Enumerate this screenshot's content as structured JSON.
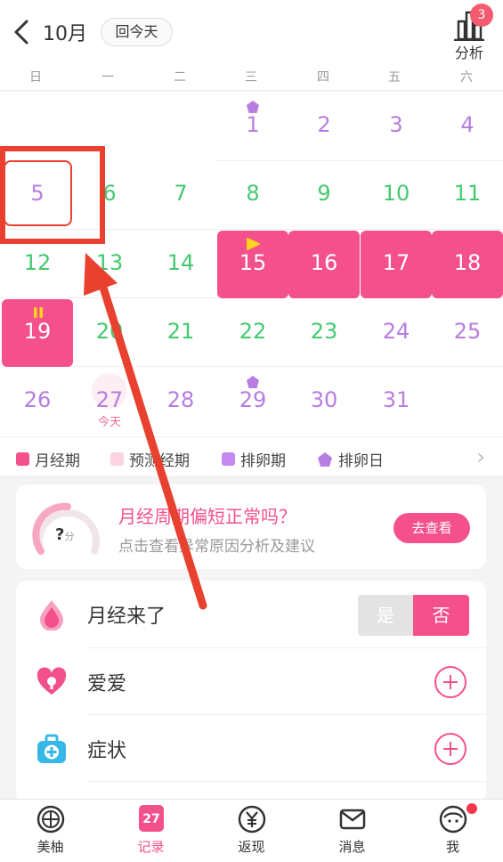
{
  "header": {
    "month": "10月",
    "today_button": "回今天",
    "analysis_label": "分析",
    "badge": "3"
  },
  "weekdays": [
    "日",
    "一",
    "二",
    "三",
    "四",
    "五",
    "六"
  ],
  "calendar": {
    "days": [
      {
        "day": "1",
        "col": 3,
        "row": 0,
        "type": "purple",
        "marker": "ovulation-day"
      },
      {
        "day": "2",
        "col": 4,
        "row": 0,
        "type": "purple"
      },
      {
        "day": "3",
        "col": 5,
        "row": 0,
        "type": "purple"
      },
      {
        "day": "4",
        "col": 6,
        "row": 0,
        "type": "purple"
      },
      {
        "day": "5",
        "col": 0,
        "row": 1,
        "type": "purple"
      },
      {
        "day": "6",
        "col": 1,
        "row": 1,
        "type": "green"
      },
      {
        "day": "7",
        "col": 2,
        "row": 1,
        "type": "green"
      },
      {
        "day": "8",
        "col": 3,
        "row": 1,
        "type": "green"
      },
      {
        "day": "9",
        "col": 4,
        "row": 1,
        "type": "green"
      },
      {
        "day": "10",
        "col": 5,
        "row": 1,
        "type": "green"
      },
      {
        "day": "11",
        "col": 6,
        "row": 1,
        "type": "green"
      },
      {
        "day": "12",
        "col": 0,
        "row": 2,
        "type": "green"
      },
      {
        "day": "13",
        "col": 1,
        "row": 2,
        "type": "green"
      },
      {
        "day": "14",
        "col": 2,
        "row": 2,
        "type": "green"
      },
      {
        "day": "15",
        "col": 3,
        "row": 2,
        "type": "period",
        "marker": "start"
      },
      {
        "day": "16",
        "col": 4,
        "row": 2,
        "type": "period"
      },
      {
        "day": "17",
        "col": 5,
        "row": 2,
        "type": "period"
      },
      {
        "day": "18",
        "col": 6,
        "row": 2,
        "type": "period"
      },
      {
        "day": "19",
        "col": 0,
        "row": 3,
        "type": "period",
        "marker": "end"
      },
      {
        "day": "20",
        "col": 1,
        "row": 3,
        "type": "green"
      },
      {
        "day": "21",
        "col": 2,
        "row": 3,
        "type": "green"
      },
      {
        "day": "22",
        "col": 3,
        "row": 3,
        "type": "green"
      },
      {
        "day": "23",
        "col": 4,
        "row": 3,
        "type": "green"
      },
      {
        "day": "24",
        "col": 5,
        "row": 3,
        "type": "purple"
      },
      {
        "day": "25",
        "col": 6,
        "row": 3,
        "type": "purple"
      },
      {
        "day": "26",
        "col": 0,
        "row": 4,
        "type": "purple"
      },
      {
        "day": "27",
        "col": 1,
        "row": 4,
        "type": "purple",
        "marker": "today",
        "sub": "今天"
      },
      {
        "day": "28",
        "col": 2,
        "row": 4,
        "type": "purple"
      },
      {
        "day": "29",
        "col": 3,
        "row": 4,
        "type": "purple",
        "marker": "ovulation-day"
      },
      {
        "day": "30",
        "col": 4,
        "row": 4,
        "type": "purple"
      },
      {
        "day": "31",
        "col": 5,
        "row": 4,
        "type": "purple"
      }
    ]
  },
  "legend": {
    "items": [
      {
        "label": "月经期",
        "color": "#f4508b"
      },
      {
        "label": "预测经期",
        "color": "#fbd3e1"
      },
      {
        "label": "排卵期",
        "color": "#c48af0"
      },
      {
        "label": "排卵日",
        "color": "#b77de0"
      }
    ]
  },
  "cycle_card": {
    "score": "?",
    "score_unit": "分",
    "title": "月经周期偏短正常吗？",
    "subtitle": "点击查看异常原因分析及建议",
    "button": "去查看"
  },
  "records": {
    "period": {
      "label": "月经来了",
      "yes": "是",
      "no": "否",
      "selected": "否"
    },
    "love": {
      "label": "爱爱"
    },
    "symptom": {
      "label": "症状"
    }
  },
  "tabs": [
    {
      "label": "美柚",
      "icon": "grapefruit-icon"
    },
    {
      "label": "记录",
      "icon": "calendar-icon",
      "active": true,
      "day": "27"
    },
    {
      "label": "返现",
      "icon": "yuan-icon"
    },
    {
      "label": "消息",
      "icon": "mail-icon"
    },
    {
      "label": "我",
      "icon": "profile-icon",
      "dot": true
    }
  ],
  "colors": {
    "accent": "#f4508b",
    "green": "#45c96e",
    "purple": "#b77de0",
    "annotation": "#e8412f"
  }
}
